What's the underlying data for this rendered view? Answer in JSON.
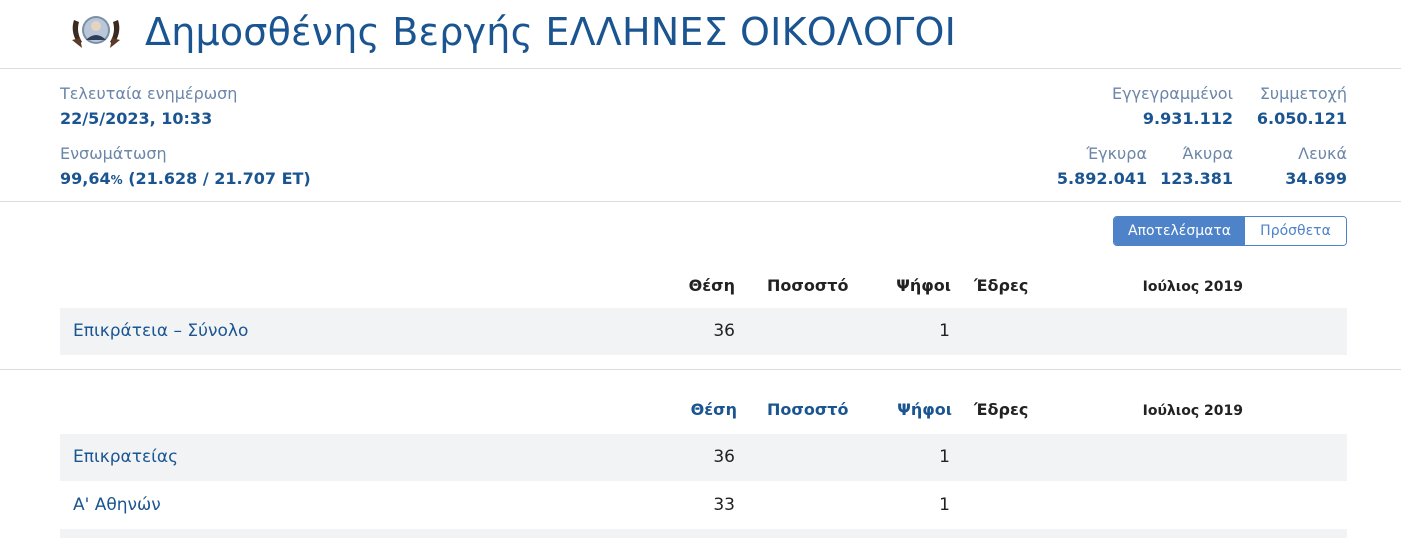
{
  "header": {
    "title": "Δημοσθένης Βεργής ΕΛΛΗΝΕΣ ΟΙΚΟΛΟΓΟΙ",
    "logo_icon": "party-logo-icon"
  },
  "stats": {
    "last_update_label": "Τελευταία ενημέρωση",
    "last_update_value": "22/5/2023, 10:33",
    "incorporation_label": "Ενσωμάτωση",
    "incorporation_percent": "99,64",
    "incorporation_pct_sign": "%",
    "incorporation_detail": " (21.628 / 21.707 ΕΤ)",
    "registered_label": "Εγγεγραμμένοι",
    "registered_value": "9.931.112",
    "turnout_label": "Συμμετοχή",
    "turnout_value": "6.050.121",
    "valid_label": "Έγκυρα",
    "valid_value": "5.892.041",
    "invalid_label": "Άκυρα",
    "invalid_value": "123.381",
    "blank_label": "Λευκά",
    "blank_value": "34.699"
  },
  "toggle": {
    "results_label": "Αποτελέσματα",
    "extra_label": "Πρόσθετα"
  },
  "table1": {
    "headers": {
      "position": "Θέση",
      "percent": "Ποσοστό",
      "votes": "Ψήφοι",
      "seats": "Έδρες",
      "compare": "Ιούλιος 2019"
    },
    "rows": [
      {
        "name": "Επικράτεια – Σύνολο",
        "position": "36",
        "votes": "1"
      }
    ]
  },
  "table2": {
    "headers": {
      "position": "Θέση",
      "percent": "Ποσοστό",
      "votes": "Ψήφοι",
      "seats": "Έδρες",
      "compare": "Ιούλιος 2019"
    },
    "rows": [
      {
        "name": "Επικρατείας",
        "position": "36",
        "votes": "1"
      },
      {
        "name": "Α' Αθηνών",
        "position": "33",
        "votes": "1"
      }
    ]
  },
  "colors": {
    "primary": "#1b5591",
    "label": "#6b86a8",
    "accent": "#4e82c9",
    "row_shade": "#f2f3f5"
  }
}
